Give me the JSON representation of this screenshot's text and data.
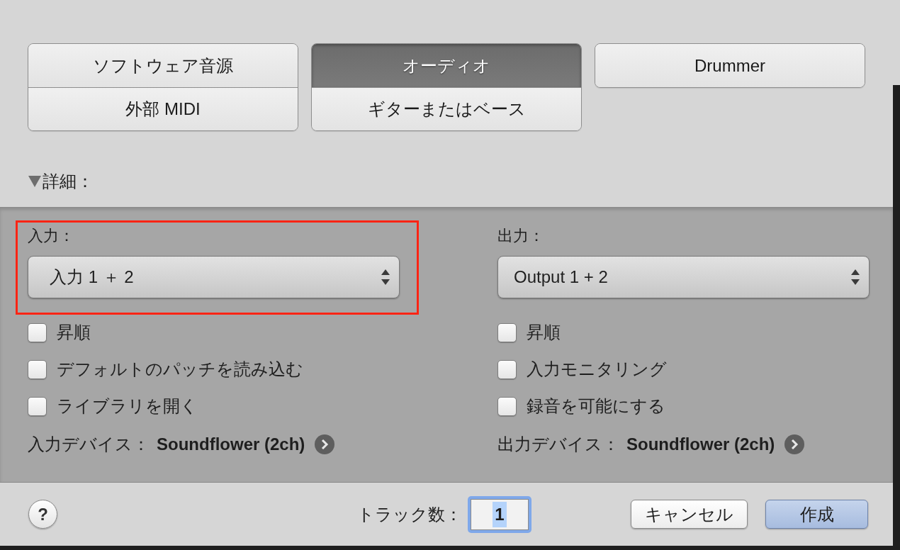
{
  "track_type_groups": [
    {
      "options": [
        {
          "label": "ソフトウェア音源",
          "selected": false
        },
        {
          "label": "外部 MIDI",
          "selected": false
        }
      ]
    },
    {
      "options": [
        {
          "label": "オーディオ",
          "selected": true
        },
        {
          "label": "ギターまたはベース",
          "selected": false
        }
      ]
    },
    {
      "options": [
        {
          "label": "Drummer",
          "selected": false
        }
      ]
    }
  ],
  "details": {
    "label": "詳細：",
    "expanded": true
  },
  "columns": [
    {
      "label": "入力：",
      "value": "入力 1 ＋ 2",
      "highlighted": true,
      "options": [
        {
          "label": "昇順",
          "checked": false
        },
        {
          "label": "デフォルトのパッチを読み込む",
          "checked": false
        },
        {
          "label": "ライブラリを開く",
          "checked": false
        }
      ],
      "device_label": "入力デバイス：",
      "device": "Soundflower (2ch)"
    },
    {
      "label": "出力：",
      "value": "Output 1 + 2",
      "highlighted": false,
      "options": [
        {
          "label": "昇順",
          "checked": false
        },
        {
          "label": "入力モニタリング",
          "checked": false
        },
        {
          "label": "録音を可能にする",
          "checked": false
        }
      ],
      "device_label": "出力デバイス：",
      "device": "Soundflower (2ch)"
    }
  ],
  "footer": {
    "help": "?",
    "track_count_label": "トラック数：",
    "track_count": {
      "value": "1",
      "focused": true,
      "text_selected": true
    },
    "buttons": [
      {
        "label": "キャンセル",
        "kind": "normal"
      },
      {
        "label": "作成",
        "kind": "default"
      }
    ]
  }
}
